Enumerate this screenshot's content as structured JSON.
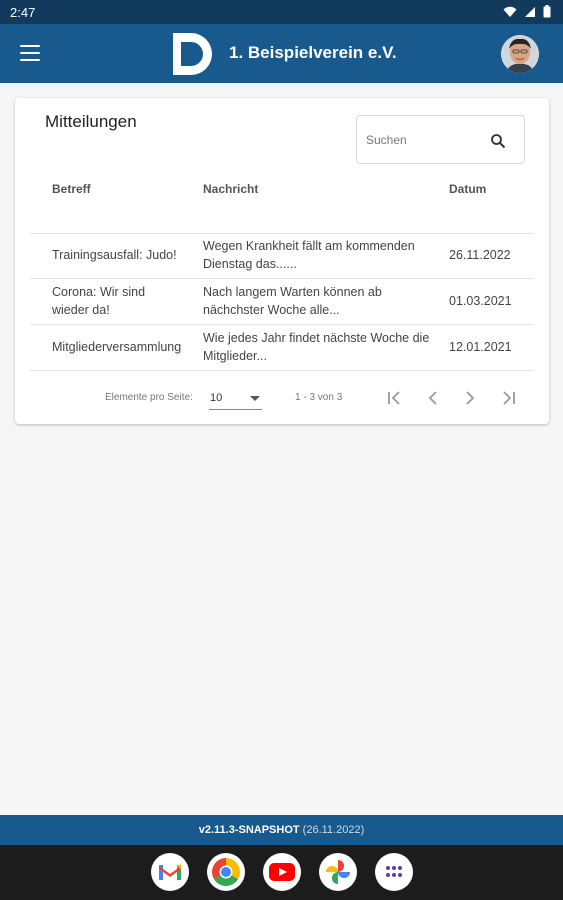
{
  "status_bar": {
    "time": "2:47"
  },
  "app_bar": {
    "title": "1. Beispielverein e.V."
  },
  "card": {
    "title": "Mitteilungen",
    "search": {
      "placeholder": "Suchen",
      "value": ""
    },
    "columns": {
      "betreff": "Betreff",
      "nachricht": "Nachricht",
      "datum": "Datum"
    },
    "rows": [
      {
        "betreff": "Trainingsausfall: Judo!",
        "nachricht": "Wegen Krankheit fällt am kommenden Dienstag das......",
        "datum": "26.11.2022"
      },
      {
        "betreff": "Corona: Wir sind wieder da!",
        "nachricht": "Nach langem Warten können ab nächchster Woche alle...",
        "datum": "01.03.2021"
      },
      {
        "betreff": "Mitgliederversammlung",
        "nachricht": "Wie jedes Jahr findet nächste Woche die Mitglieder...",
        "datum": "12.01.2021"
      }
    ],
    "paginator": {
      "items_label": "Elemente pro Seite:",
      "page_size": "10",
      "range": "1 - 3 von 3"
    }
  },
  "footer": {
    "version": "v2.11.3-SNAPSHOT",
    "build_date": "(26.11.2022)"
  },
  "dock_apps": [
    "gmail-icon",
    "chrome-icon",
    "youtube-icon",
    "photos-icon",
    "app-drawer-icon"
  ],
  "colors": {
    "primary": "#185a8d",
    "status_bar": "#113a5c"
  }
}
